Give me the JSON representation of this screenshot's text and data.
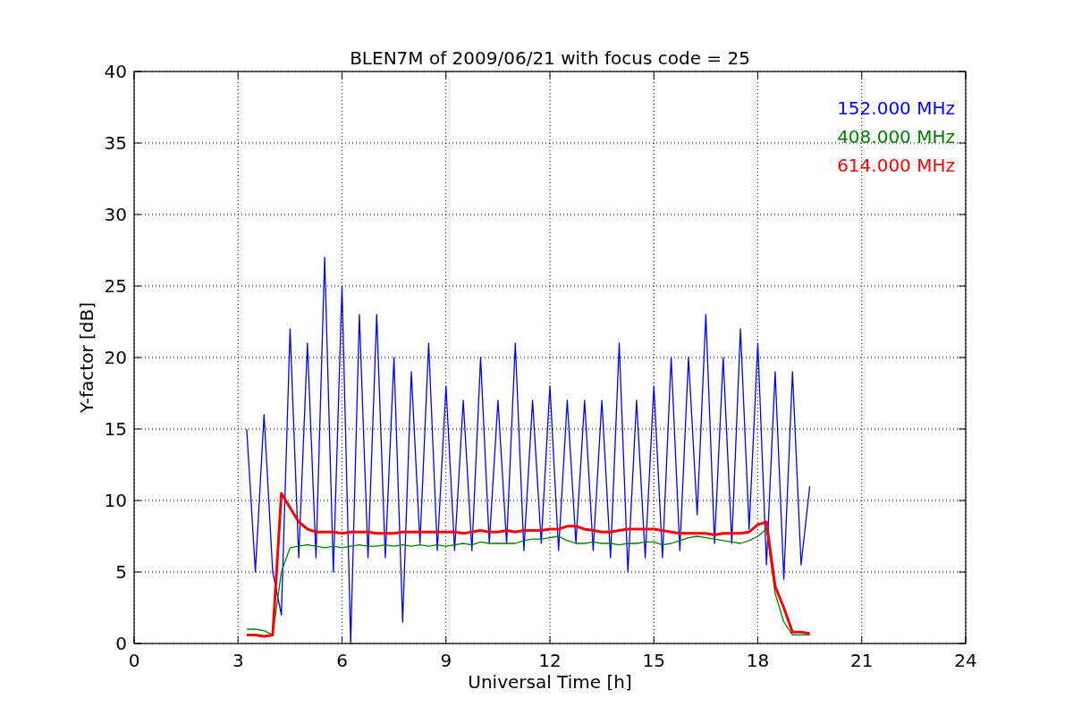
{
  "figure": {
    "chart_data": {
      "type": "line",
      "grid": true,
      "title": "BLEN7M of 2009/06/21 with focus code = 25",
      "xlabel": "Universal Time [h]",
      "ylabel": "Y-factor [dB]",
      "xlim": [
        0,
        24
      ],
      "ylim": [
        0,
        40
      ],
      "xticks": [
        0,
        3,
        6,
        9,
        12,
        15,
        18,
        21,
        24
      ],
      "yticks": [
        0,
        5,
        10,
        15,
        20,
        25,
        30,
        35,
        40
      ],
      "x": [
        3.25,
        3.5,
        3.75,
        4,
        4.25,
        4.5,
        4.75,
        5,
        5.25,
        5.5,
        5.75,
        6,
        6.25,
        6.5,
        6.75,
        7,
        7.25,
        7.5,
        7.75,
        8,
        8.25,
        8.5,
        8.75,
        9,
        9.25,
        9.5,
        9.75,
        10,
        10.25,
        10.5,
        10.75,
        11,
        11.25,
        11.5,
        11.75,
        12,
        12.25,
        12.5,
        12.75,
        13,
        13.25,
        13.5,
        13.75,
        14,
        14.25,
        14.5,
        14.75,
        15,
        15.25,
        15.5,
        15.75,
        16,
        16.25,
        16.5,
        16.75,
        17,
        17.25,
        17.5,
        17.75,
        18,
        18.25,
        18.5,
        18.75,
        19,
        19.25,
        19.5
      ],
      "series": [
        {
          "name": "152.000 MHz",
          "color": "#0000ff",
          "values": [
            15,
            5,
            16,
            5,
            2,
            22,
            6,
            21,
            6,
            27,
            5,
            25,
            0,
            23,
            6,
            23,
            6,
            20,
            1.5,
            19,
            7,
            21,
            6.5,
            18,
            6.5,
            17,
            6.5,
            20,
            7,
            17,
            7,
            21,
            6.5,
            17,
            7,
            18,
            6.5,
            17,
            7,
            17,
            6.5,
            17,
            6,
            21,
            5,
            17,
            6,
            18,
            6,
            20,
            6.5,
            20,
            9,
            23,
            7,
            20,
            7,
            22,
            8,
            21,
            5.5,
            19,
            4.5,
            19,
            5.5,
            11
          ]
        },
        {
          "name": "408.000 MHz",
          "color": "#008000",
          "values": [
            1,
            1,
            0.9,
            0.6,
            5,
            6.7,
            6.8,
            6.9,
            6.8,
            6.7,
            6.8,
            6.7,
            6.8,
            6.9,
            6.8,
            6.8,
            6.9,
            6.8,
            6.9,
            6.8,
            6.9,
            6.8,
            6.9,
            6.8,
            6.9,
            7,
            6.9,
            7.1,
            7,
            7,
            7,
            7,
            7.2,
            7.3,
            7.3,
            7.4,
            7.5,
            7.2,
            7,
            7,
            7.1,
            7,
            7,
            6.9,
            7,
            7,
            7.1,
            7.1,
            6.9,
            7,
            7.2,
            7.4,
            7.5,
            7.4,
            7.3,
            7.2,
            7.1,
            7,
            7.2,
            7.5,
            8,
            3.5,
            1.5,
            0.6,
            0.6,
            0.6
          ]
        },
        {
          "name": "614.000 MHz",
          "color": "#ff0000",
          "values": [
            0.6,
            0.6,
            0.5,
            0.6,
            10.5,
            9.5,
            8.5,
            8,
            7.8,
            7.8,
            7.8,
            7.7,
            7.8,
            7.8,
            7.8,
            7.7,
            7.7,
            7.7,
            7.8,
            7.8,
            7.8,
            7.8,
            7.8,
            7.8,
            7.8,
            7.7,
            7.8,
            7.9,
            7.8,
            7.8,
            7.9,
            7.8,
            7.9,
            7.9,
            7.9,
            8,
            8,
            8.2,
            8.2,
            8,
            7.9,
            7.8,
            7.8,
            7.9,
            8,
            8,
            8,
            8,
            7.9,
            7.8,
            7.7,
            7.7,
            7.7,
            7.7,
            7.6,
            7.7,
            7.7,
            7.7,
            7.8,
            8.3,
            8.5,
            4,
            2.5,
            0.8,
            0.8,
            0.7
          ]
        }
      ]
    }
  }
}
